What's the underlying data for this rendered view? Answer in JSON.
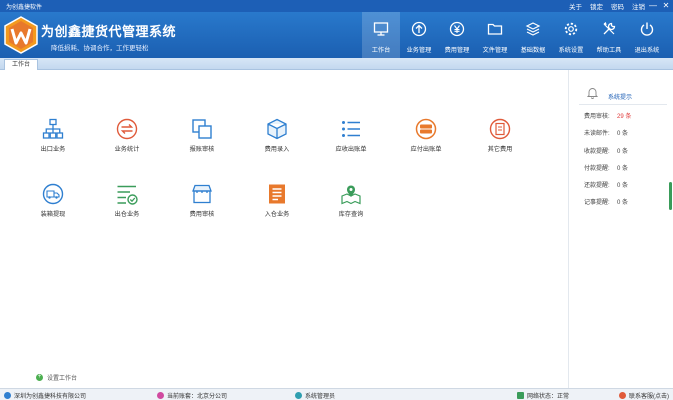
{
  "window": {
    "title": "为创鑫捷软件",
    "links": [
      "关于",
      "锁定",
      "密码",
      "注销"
    ],
    "controls": [
      "—",
      "✕"
    ]
  },
  "brand": {
    "title": "为创鑫捷货代管理系统",
    "subtitle": "降低损耗、协调合作，工作更轻松",
    "color": "#1d5fb6"
  },
  "nav": [
    {
      "label": "工作台",
      "icon": "monitor-icon",
      "active": true
    },
    {
      "label": "业务管理",
      "icon": "upload-circle-icon"
    },
    {
      "label": "费用管理",
      "icon": "yen-circle-icon"
    },
    {
      "label": "文件管理",
      "icon": "folder-icon"
    },
    {
      "label": "基础数据",
      "icon": "layers-icon"
    },
    {
      "label": "系统设置",
      "icon": "gear-icon"
    },
    {
      "label": "帮助工具",
      "icon": "tools-icon"
    },
    {
      "label": "退出系统",
      "icon": "power-icon"
    }
  ],
  "tab": {
    "label": "工作台"
  },
  "tiles": [
    {
      "label": "出口业务",
      "icon": "org-chart-icon"
    },
    {
      "label": "业务统计",
      "icon": "exchange-icon"
    },
    {
      "label": "报账审核",
      "icon": "copy-icon"
    },
    {
      "label": "费用录入",
      "icon": "cube-icon"
    },
    {
      "label": "应收出账单",
      "icon": "list-icon"
    },
    {
      "label": "应付出账单",
      "icon": "bill-badge-icon"
    },
    {
      "label": "其它费用",
      "icon": "receipt-icon"
    },
    {
      "label": "装箱提现",
      "icon": "truck-icon"
    },
    {
      "label": "出仓业务",
      "icon": "list-check-icon"
    },
    {
      "label": "费用审核",
      "icon": "store-icon"
    },
    {
      "label": "入仓业务",
      "icon": "document-icon"
    },
    {
      "label": "库存查询",
      "icon": "map-pin-icon"
    }
  ],
  "setup": {
    "label": "设置工作台"
  },
  "side": {
    "title": "系统提示",
    "rows": [
      {
        "label": "费用审核:",
        "value": "29 条",
        "highlight": true
      },
      {
        "label": "未读邮件:",
        "value": "0 条"
      },
      {
        "label": "收款提醒:",
        "value": "0 条"
      },
      {
        "label": "付款提醒:",
        "value": "0 条"
      },
      {
        "label": "还款提醒:",
        "value": "0 条"
      },
      {
        "label": "记事提醒:",
        "value": "0 条"
      }
    ]
  },
  "status": {
    "company": "深圳为创鑫捷科技有限公司",
    "account": "当前账套：北京分公司",
    "user": "系统管理员",
    "network": "网络状态：正常",
    "contact": "联系客服(点击)"
  },
  "colors": {
    "accent": "#1d5fb6",
    "orange": "#e8792c",
    "green": "#3a9c5a",
    "red": "#e03a3a"
  }
}
